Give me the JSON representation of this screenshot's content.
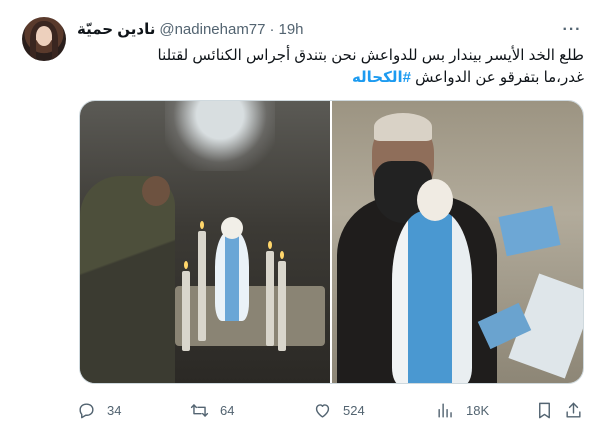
{
  "tweet": {
    "display_name": "نادين حميّة",
    "handle": "@nadineham77",
    "separator": "·",
    "time": "19h",
    "more_icon": "more-horizontal-icon",
    "text_line1": "طلع الخد الأيسر بيندار بس للدواعش نحن بتندق أجراس الكنائس لقتلنا",
    "text_line2": "غدر،ما بتفرقو عن الدواعش",
    "hashtag": "#الكحاله"
  },
  "media": {
    "left_alt_icon": "photo-soldier-candles",
    "right_alt_icon": "photo-cleric-statue"
  },
  "actions": {
    "reply": {
      "icon": "reply-icon",
      "count": "34"
    },
    "retweet": {
      "icon": "retweet-icon",
      "count": "64"
    },
    "like": {
      "icon": "heart-icon",
      "count": "524"
    },
    "views": {
      "icon": "views-icon",
      "count": "18K"
    },
    "bookmark": {
      "icon": "bookmark-icon"
    },
    "share": {
      "icon": "share-icon"
    }
  },
  "colors": {
    "text": "#0f1419",
    "secondary": "#536471",
    "accent": "#1d9bf0",
    "border": "#cfd9de"
  }
}
